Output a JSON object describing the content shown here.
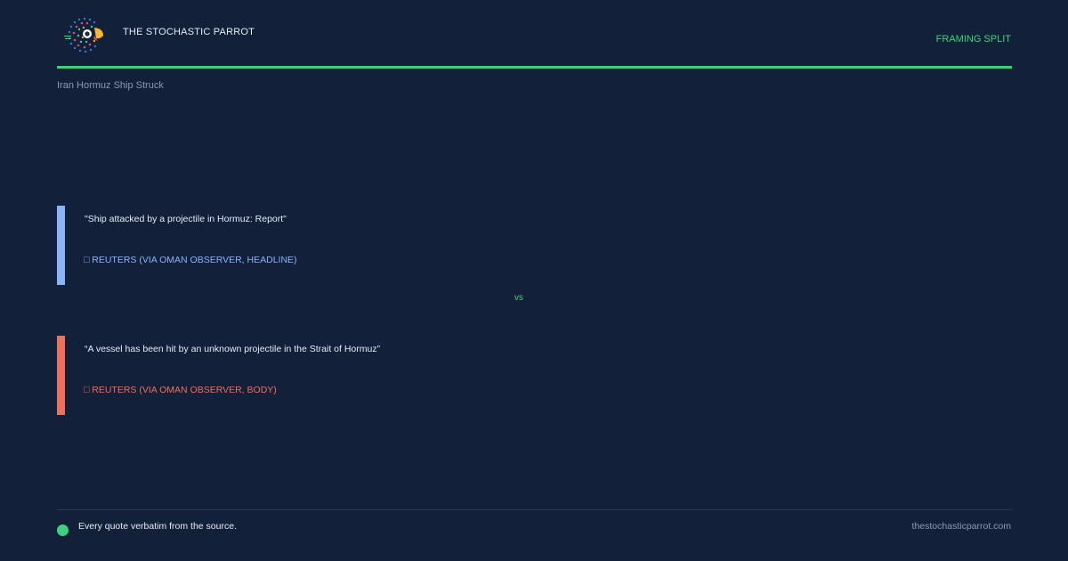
{
  "header": {
    "logo_icon": "parrot-logo-icon",
    "brand": "THE STOCHASTIC PARROT",
    "tag": "FRAMING SPLIT",
    "accent_color": "#3fd07f"
  },
  "topic": "Iran Hormuz Ship Struck",
  "comparison": {
    "a": {
      "quote": "\"Ship attacked by a projectile in Hormuz: Report\"",
      "source": "□ REUTERS (VIA OMAN OBSERVER, HEADLINE)",
      "color": "#8ab4f8"
    },
    "separator": "vs",
    "b": {
      "quote": "“A vessel has been hit by an unknown projectile in the Strait of Hormuz”",
      "source": "□ REUTERS (VIA OMAN OBSERVER, BODY)",
      "color": "#ee6f5b"
    }
  },
  "footer": {
    "dot_icon": "green-dot-icon",
    "note": "Every quote verbatim from the source.",
    "url": "thestochasticparrot.com"
  }
}
